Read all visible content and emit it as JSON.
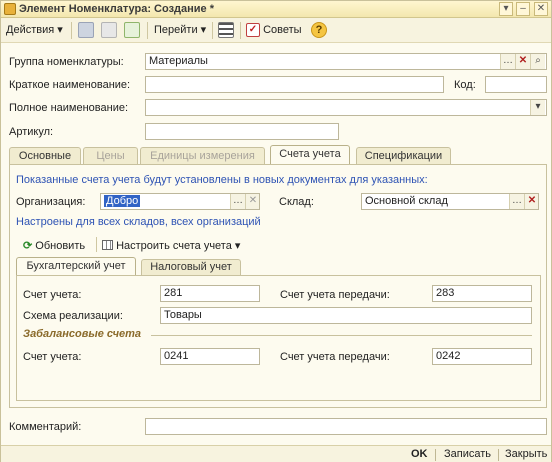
{
  "window": {
    "title": "Элемент Номенклатура: Создание *"
  },
  "toolbar": {
    "actions_label": "Действия",
    "goto_label": "Перейти",
    "tips_label": "Советы",
    "help_label": "?"
  },
  "form": {
    "group_label": "Группа номенклатуры:",
    "group_value": "Материалы",
    "short_name_label": "Краткое наименование:",
    "short_name_value": "",
    "code_label": "Код:",
    "code_value": "",
    "full_name_label": "Полное наименование:",
    "full_name_value": "",
    "article_label": "Артикул:",
    "article_value": ""
  },
  "tabs": [
    {
      "label": "Основные",
      "state": "normal"
    },
    {
      "label": "Цены",
      "state": "disabled"
    },
    {
      "label": "Единицы измерения",
      "state": "disabled"
    },
    {
      "label": "Счета учета",
      "state": "active"
    },
    {
      "label": "Спецификации",
      "state": "normal"
    }
  ],
  "accounts_tab": {
    "info_text": "Показанные счета учета будут установлены в новых документах для указанных:",
    "org_label": "Организация:",
    "org_value": "Добро",
    "warehouse_label": "Склад:",
    "warehouse_value": "Основной склад",
    "configured_text": "Настроены для всех складов, всех организаций",
    "refresh_label": "Обновить",
    "configure_label": "Настроить счета учета",
    "subtabs": [
      {
        "label": "Бухгалтерский учет",
        "state": "active"
      },
      {
        "label": "Налоговый учет",
        "state": "normal"
      }
    ],
    "account_label": "Счет учета:",
    "account_value": "281",
    "transfer_account_label": "Счет учета передачи:",
    "transfer_account_value": "283",
    "sales_scheme_label": "Схема реализации:",
    "sales_scheme_value": "Товары",
    "off_balance_title": "Забалансовые счета",
    "ob_account_label": "Счет учета:",
    "ob_account_value": "0241",
    "ob_transfer_label": "Счет учета передачи:",
    "ob_transfer_value": "0242"
  },
  "comment": {
    "label": "Комментарий:",
    "value": ""
  },
  "footer": {
    "ok_label": "OK",
    "save_label": "Записать",
    "close_label": "Закрыть"
  },
  "colors": {
    "window_bg": "#fdfbef",
    "accent_blue": "#2e53b4",
    "section_brown": "#8a6a2a"
  }
}
